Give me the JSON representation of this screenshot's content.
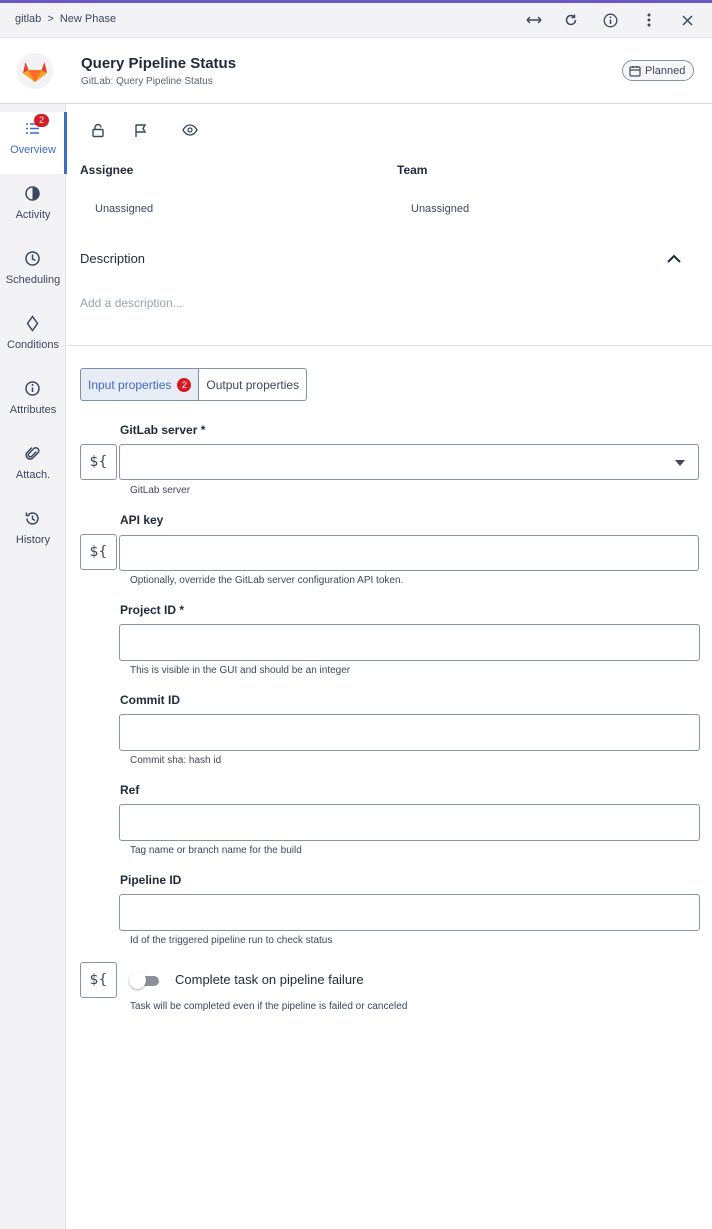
{
  "topbar": {
    "breadcrumb": [
      "gitlab",
      ">",
      "New Phase"
    ]
  },
  "header": {
    "title": "Query Pipeline Status",
    "subtitle": "GitLab: Query Pipeline Status",
    "status": "Planned"
  },
  "sidebar": {
    "items": [
      {
        "label": "Overview",
        "icon": "list-icon",
        "badge": "2",
        "active": true
      },
      {
        "label": "Activity",
        "icon": "pie-icon"
      },
      {
        "label": "Scheduling",
        "icon": "clock-icon"
      },
      {
        "label": "Conditions",
        "icon": "diamond-icon"
      },
      {
        "label": "Attributes",
        "icon": "info-icon"
      },
      {
        "label": "Attach.",
        "icon": "paperclip-icon"
      },
      {
        "label": "History",
        "icon": "history-icon"
      }
    ]
  },
  "overview": {
    "assignee_label": "Assignee",
    "assignee_value": "Unassigned",
    "team_label": "Team",
    "team_value": "Unassigned",
    "description_title": "Description",
    "description_placeholder": "Add a description..."
  },
  "tabs": {
    "input_label": "Input properties",
    "input_badge": "2",
    "output_label": "Output properties"
  },
  "fields": {
    "gitlab_server": {
      "label": "GitLab server *",
      "value": "",
      "helper": "GitLab server"
    },
    "api_key": {
      "label": "API key",
      "value": "",
      "helper": "Optionally, override the GitLab server configuration API token."
    },
    "project_id": {
      "label": "Project ID *",
      "value": "",
      "helper": "This is visible in the GUI and should be an integer"
    },
    "commit_id": {
      "label": "Commit ID",
      "value": "",
      "helper": "Commit sha: hash id"
    },
    "ref": {
      "label": "Ref",
      "value": "",
      "helper": "Tag name or branch name for the build"
    },
    "pipeline_id": {
      "label": "Pipeline ID",
      "value": "",
      "helper": "Id of the triggered pipeline run to check status"
    }
  },
  "expression_button": "${",
  "toggle": {
    "label": "Complete task on pipeline failure",
    "helper": "Task will be completed even if the pipeline is failed or canceled",
    "on": false
  },
  "colors": {
    "accent": "#3d6cc5",
    "badge": "#d81a24",
    "top_accent": "#6b57c9",
    "gitlab_orange": "#fc6d26"
  }
}
